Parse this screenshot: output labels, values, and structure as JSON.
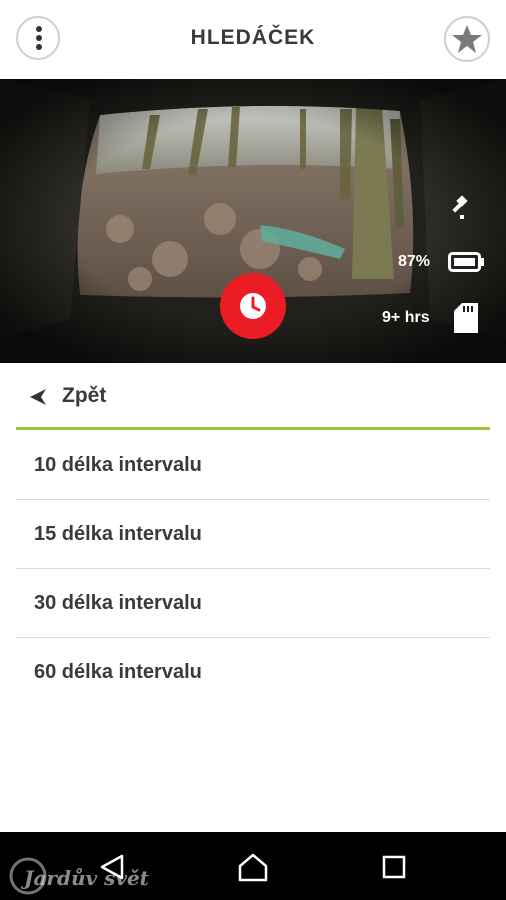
{
  "header": {
    "title": "HLEDÁČEK",
    "menu_icon": "more-vert-icon",
    "favorite_icon": "star-icon"
  },
  "camera": {
    "battery_percent": "87%",
    "remaining_time": "9+ hrs",
    "gps_icon": "satellite-icon",
    "battery_icon": "battery-icon",
    "storage_icon": "sd-card-icon",
    "record_icon": "clock-icon",
    "record_color": "#ec1c24"
  },
  "menu": {
    "back_label": "Zpět",
    "accent_color": "#9bc53d",
    "items": [
      {
        "label": "10 délka intervalu"
      },
      {
        "label": "15 délka intervalu"
      },
      {
        "label": "30 délka intervalu"
      },
      {
        "label": "60 délka intervalu"
      }
    ]
  },
  "nav": {
    "back_icon": "triangle-back-icon",
    "home_icon": "home-icon",
    "recents_icon": "square-recents-icon"
  },
  "watermark": {
    "text": "Jardův svět"
  }
}
